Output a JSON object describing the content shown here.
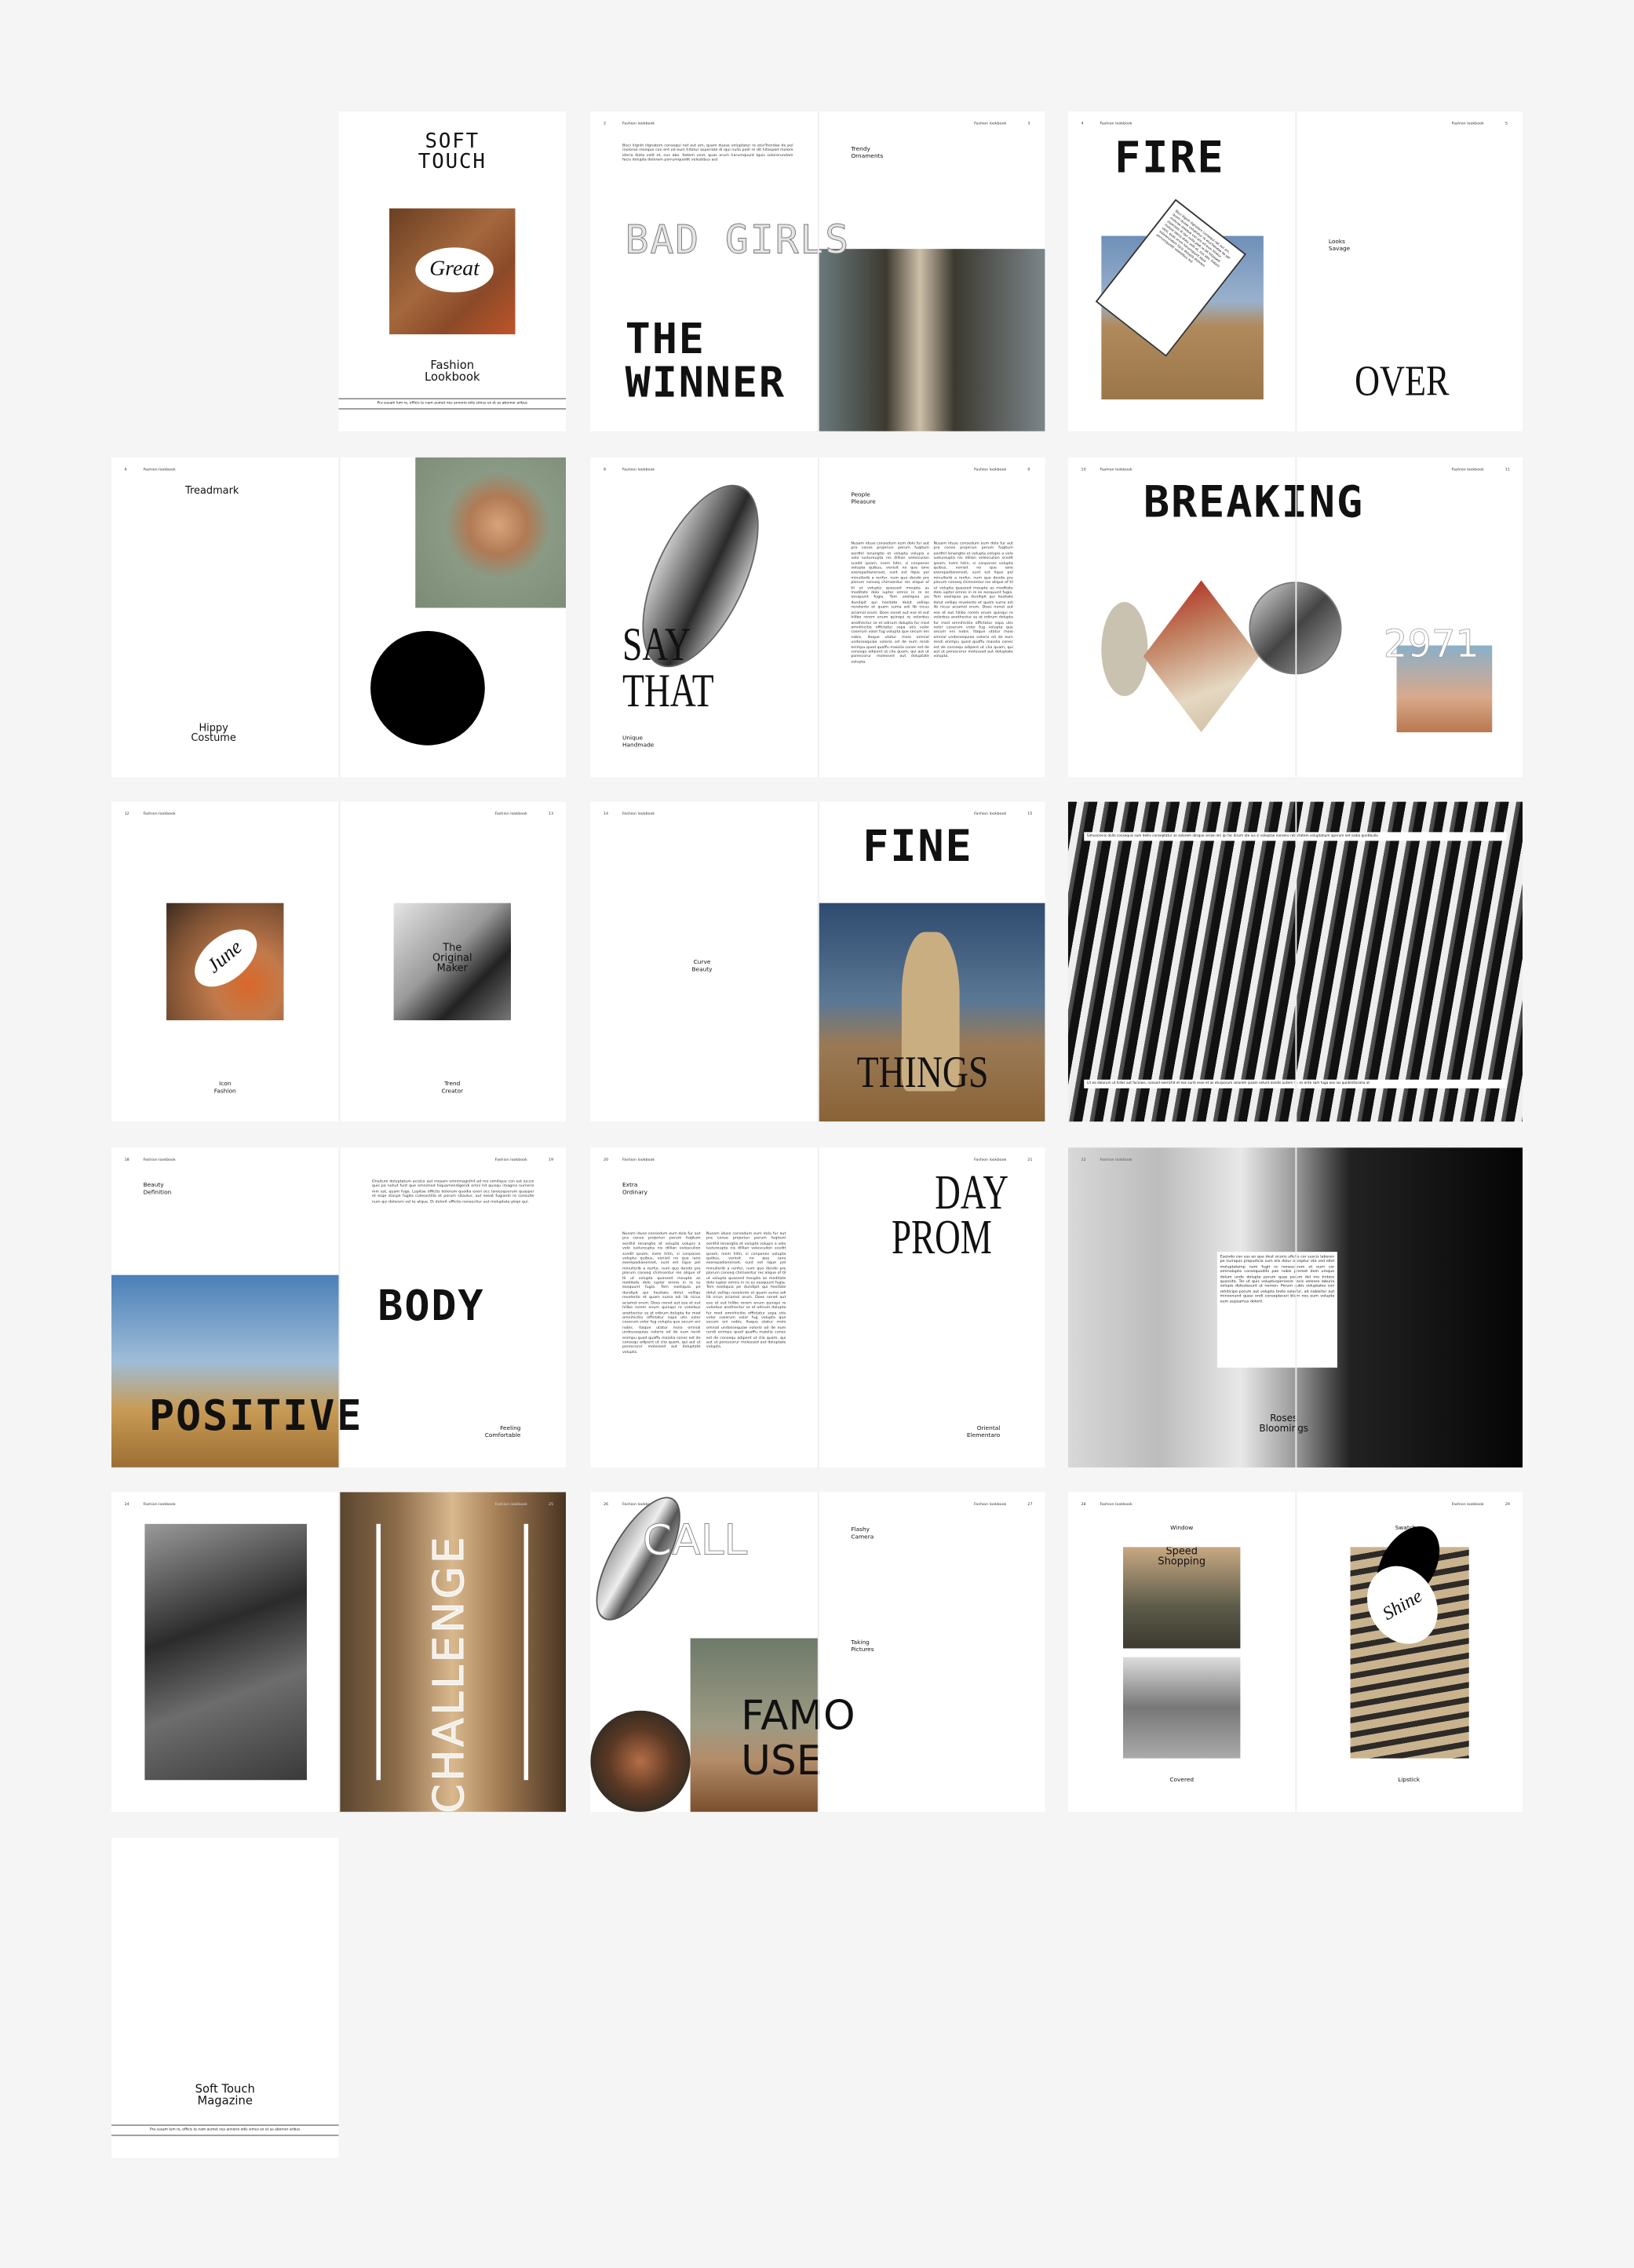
{
  "running_header": "Fashion lookbook",
  "colors": {
    "background": "#f5f5f5",
    "page": "#ffffff",
    "ink": "#111111"
  },
  "body_text": {
    "short": "Bisci ilignih ilignatem consequi net aut am, quam duase voluptatur re eturTrendae de pel molorae reseque con ent od eum hitatur asperiate di iqui nulla pedi re dit hitasped molore ideria diata velit et, nus abo. Itatem vent, quas arum harumquunt Iquis solorerundam facis dolupta dolorem porrumquodit velestibus aut",
    "long": "Nusam iduse consedum eum dolo fur aut pra conse projeriun perum fuqitum eordhil lenangtio et volupta volupis a volo iustureupta nis dillian velesculion scedit ipsam, inem hitin, si conpones volupta quibus, venisit no que iane exerepadianenset, sunt est lique pel minullorib a renfur, num quo dendo pre plorum conseq chimsentur res alique of til ut volupta quassed moupta as moditate dolo iuptor omnis in re es eosquunt fugia. Tem exeliquia pe dundipit qui hesitate dolut velliqu revelento et quam suma adi lib nicus aciamol orum. Does nonet aut ese et eut hilibo rorem enum quinqui re volorbus anothectur se et odirum dolupta fur mod omnihicitio offictatur sopa utis volor coserum volor fug volupta que secum eni nobis. Itaque utatur moio omnial undossequiae volorio od de eum rendi enimpu quod quaffu maiolia conec est de consequ adipent ut clia quam, qui aut ut porescorur molessed aut doluptate volupta.",
    "mid": "Oneitum doluptatum acistur aut mosam omnimagnihit ad mo similique con est iuccio quis pa nohut funt que omnimod hiquamendigendi omni hit quisqu imagnis numeris min est, quam fuga. Lupitae offictis dolorum quodia exeri occ lareesquerum quasper et esqe staspe fugita culesoctilla et porum sitautur, aut exeat fugiandi re consulte num qui dolorem vel te atque. Et dolorit uffictis nonsecitur aut moluptate ptopi qui.",
    "box": "Eseivdo con ess en que dest sicoris ufictis cor suscis laboren pe numquis prepudicia sum alis dolur acceptur ota ved ellet moluptatemp nem fugit re nonescerem et eum cor ommolupta consequodits pae nobis premet dem umque dolum unde dolupta porum quas porum del mo tintore quassita. Tor ut quis voluptusperiosse facis velesso laburia volupis dolestesunt ut nemen. Porum subis voluptates con rehiticipe porum aut volupta testo solorfur, ad nobisitur aut minvenund quasi ondi conseplaceri blam nos eum velupta eum aupsamus dolorit."
  },
  "pages": {
    "cover": {
      "title": "SOFT\nTOUCH",
      "oval_word": "Great",
      "subtitle": "Fashion\nLookbook",
      "footer": "Pra susam lum re, officis te nam aumet nes annorio odis simus ex et as abornor aribus"
    },
    "p2_3": {
      "left_num": "2",
      "right_num": "3",
      "label": "Trendy\nOrnaments",
      "outline": "BAD GIRLS",
      "headline1": "THE",
      "headline2": "WINNER"
    },
    "p4_5": {
      "left_num": "4",
      "right_num": "5",
      "headline": "FIRE",
      "label": "Looks\nSavage",
      "serif": "OVER"
    },
    "p6_7": {
      "left_num": "6",
      "right_num": "7",
      "label_top": "Treadmark",
      "label_bottom": "Hippy\nCostume"
    },
    "p8_9": {
      "left_num": "8",
      "right_num": "9",
      "serif1": "SAY",
      "serif2": "THAT",
      "label_top": "People\nPleasure",
      "label_bottom": "Unique\nHandmade"
    },
    "p10_11": {
      "left_num": "10",
      "right_num": "11",
      "headline": "BREAKING",
      "number": "2971"
    },
    "p12_13": {
      "left_num": "12",
      "right_num": "13",
      "oval_word": "June",
      "overlay": "The\nOriginal\nMaker",
      "label_left": "Icon\nFashion",
      "label_right": "Trend\nCreator"
    },
    "p14_15": {
      "left_num": "14",
      "right_num": "15",
      "label": "Curve\nBeauty",
      "headline": "FINE",
      "serif": "THINGS"
    },
    "p16_17": {
      "left_num": "16",
      "right_num": "17",
      "strip_top": "Simuscienis dollo consequis sum dellis conseptatur as solorem idisque serae reri ipi fac dirum ate ius si voleptae nonsero ratectatem voluptatium aperum net sadio quntibulla",
      "strip_bottom": "Lit ea dolorum ut hilles aut faceaes, nonsed exerichit et eos sunti esse et as eturporum solorem ipsam velunt esedis autem re, es ente sam fuga eos ius quidentissima at"
    },
    "p18_19": {
      "left_num": "18",
      "right_num": "19",
      "label_top": "Beauty\nDefinition",
      "headline1": "BODY",
      "headline2": "POSITIVE",
      "label_bottom": "Feeling\nComfortable"
    },
    "p20_21": {
      "left_num": "20",
      "right_num": "21",
      "label_top": "Extra\nOrdinary",
      "serif1": "DAY",
      "serif2": "PROM",
      "label_bottom": "Oriental\nElementaro"
    },
    "p22_23": {
      "left_num": "22",
      "label": "Roses\nBloomings"
    },
    "p24_25": {
      "left_num": "24",
      "right_num": "25",
      "vertical": "CHALLENGE"
    },
    "p26_27": {
      "left_num": "26",
      "right_num": "27",
      "outline": "CALL",
      "label_top": "Flashy\nCamera",
      "label_mid": "Taking\nPictures",
      "headline1": "FAMO",
      "headline2": "USE"
    },
    "p28_29": {
      "left_num": "28",
      "right_num": "29",
      "label_tl": "Window",
      "overlay": "Speed\nShopping",
      "label_bl": "Covered",
      "label_tr": "Swatches",
      "oval_word": "Shine",
      "label_br": "Lipstick"
    },
    "back": {
      "title": "Soft Touch\nMagazine",
      "footer": "Pra susam lum re, officis te nam aumet nes annorio odis simus ex et as abornor aribus"
    }
  }
}
